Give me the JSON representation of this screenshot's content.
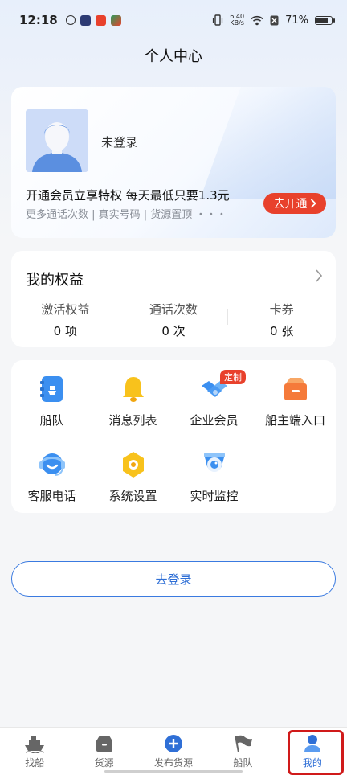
{
  "status_bar": {
    "time": "12:18",
    "net_speed_value": "6.40",
    "net_speed_unit": "KB/s",
    "battery": "71%"
  },
  "header": {
    "title": "个人中心"
  },
  "member_card": {
    "login_status": "未登录",
    "promo": "开通会员立享特权 每天最低只要1.3元",
    "promo_sub": "更多通话次数 | 真实号码 | 货源置顶 ・・・",
    "open_button": "去开通"
  },
  "rights": {
    "title": "我的权益",
    "items": [
      {
        "label": "激活权益",
        "value": "0 项"
      },
      {
        "label": "通话次数",
        "value": "0 次"
      },
      {
        "label": "卡券",
        "value": "0 张"
      }
    ]
  },
  "functions": {
    "items": [
      {
        "label": "船队",
        "icon": "fleet-icon"
      },
      {
        "label": "消息列表",
        "icon": "bell-icon"
      },
      {
        "label": "企业会员",
        "icon": "handshake-icon",
        "badge": "定制"
      },
      {
        "label": "船主端入口",
        "icon": "box-icon"
      },
      {
        "label": "客服电话",
        "icon": "headset-icon"
      },
      {
        "label": "系统设置",
        "icon": "settings-icon"
      },
      {
        "label": "实时监控",
        "icon": "camera-icon"
      }
    ]
  },
  "login_button": "去登录",
  "tabbar": {
    "items": [
      {
        "label": "找船",
        "icon": "ship-icon"
      },
      {
        "label": "货源",
        "icon": "cargo-icon"
      },
      {
        "label": "发布货源",
        "icon": "plus-circle-icon"
      },
      {
        "label": "船队",
        "icon": "flag-icon"
      },
      {
        "label": "我的",
        "icon": "person-icon",
        "active": true
      }
    ]
  },
  "colors": {
    "accent": "#2f6fd6",
    "promo_red": "#e8412c",
    "highlight": "#d01a1a"
  }
}
